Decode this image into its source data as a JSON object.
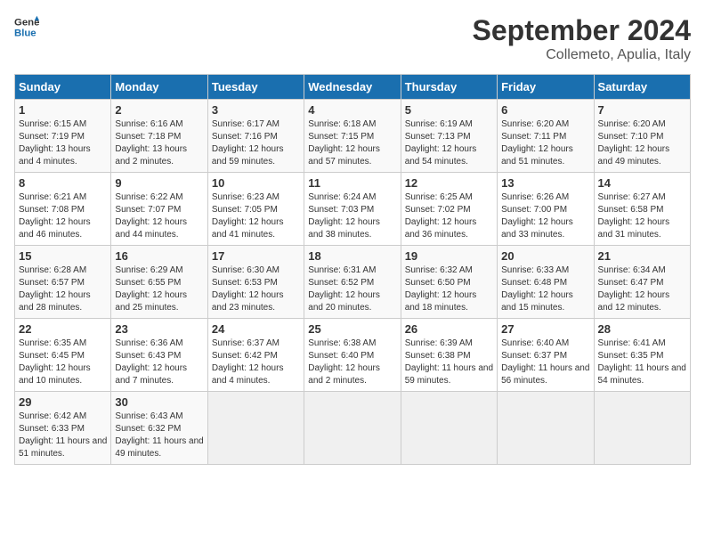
{
  "header": {
    "logo_line1": "General",
    "logo_line2": "Blue",
    "month_title": "September 2024",
    "subtitle": "Collemeto, Apulia, Italy"
  },
  "days_of_week": [
    "Sunday",
    "Monday",
    "Tuesday",
    "Wednesday",
    "Thursday",
    "Friday",
    "Saturday"
  ],
  "weeks": [
    [
      {
        "day": "1",
        "sunrise": "6:15 AM",
        "sunset": "7:19 PM",
        "daylight": "13 hours and 4 minutes."
      },
      {
        "day": "2",
        "sunrise": "6:16 AM",
        "sunset": "7:18 PM",
        "daylight": "13 hours and 2 minutes."
      },
      {
        "day": "3",
        "sunrise": "6:17 AM",
        "sunset": "7:16 PM",
        "daylight": "12 hours and 59 minutes."
      },
      {
        "day": "4",
        "sunrise": "6:18 AM",
        "sunset": "7:15 PM",
        "daylight": "12 hours and 57 minutes."
      },
      {
        "day": "5",
        "sunrise": "6:19 AM",
        "sunset": "7:13 PM",
        "daylight": "12 hours and 54 minutes."
      },
      {
        "day": "6",
        "sunrise": "6:20 AM",
        "sunset": "7:11 PM",
        "daylight": "12 hours and 51 minutes."
      },
      {
        "day": "7",
        "sunrise": "6:20 AM",
        "sunset": "7:10 PM",
        "daylight": "12 hours and 49 minutes."
      }
    ],
    [
      {
        "day": "8",
        "sunrise": "6:21 AM",
        "sunset": "7:08 PM",
        "daylight": "12 hours and 46 minutes."
      },
      {
        "day": "9",
        "sunrise": "6:22 AM",
        "sunset": "7:07 PM",
        "daylight": "12 hours and 44 minutes."
      },
      {
        "day": "10",
        "sunrise": "6:23 AM",
        "sunset": "7:05 PM",
        "daylight": "12 hours and 41 minutes."
      },
      {
        "day": "11",
        "sunrise": "6:24 AM",
        "sunset": "7:03 PM",
        "daylight": "12 hours and 38 minutes."
      },
      {
        "day": "12",
        "sunrise": "6:25 AM",
        "sunset": "7:02 PM",
        "daylight": "12 hours and 36 minutes."
      },
      {
        "day": "13",
        "sunrise": "6:26 AM",
        "sunset": "7:00 PM",
        "daylight": "12 hours and 33 minutes."
      },
      {
        "day": "14",
        "sunrise": "6:27 AM",
        "sunset": "6:58 PM",
        "daylight": "12 hours and 31 minutes."
      }
    ],
    [
      {
        "day": "15",
        "sunrise": "6:28 AM",
        "sunset": "6:57 PM",
        "daylight": "12 hours and 28 minutes."
      },
      {
        "day": "16",
        "sunrise": "6:29 AM",
        "sunset": "6:55 PM",
        "daylight": "12 hours and 25 minutes."
      },
      {
        "day": "17",
        "sunrise": "6:30 AM",
        "sunset": "6:53 PM",
        "daylight": "12 hours and 23 minutes."
      },
      {
        "day": "18",
        "sunrise": "6:31 AM",
        "sunset": "6:52 PM",
        "daylight": "12 hours and 20 minutes."
      },
      {
        "day": "19",
        "sunrise": "6:32 AM",
        "sunset": "6:50 PM",
        "daylight": "12 hours and 18 minutes."
      },
      {
        "day": "20",
        "sunrise": "6:33 AM",
        "sunset": "6:48 PM",
        "daylight": "12 hours and 15 minutes."
      },
      {
        "day": "21",
        "sunrise": "6:34 AM",
        "sunset": "6:47 PM",
        "daylight": "12 hours and 12 minutes."
      }
    ],
    [
      {
        "day": "22",
        "sunrise": "6:35 AM",
        "sunset": "6:45 PM",
        "daylight": "12 hours and 10 minutes."
      },
      {
        "day": "23",
        "sunrise": "6:36 AM",
        "sunset": "6:43 PM",
        "daylight": "12 hours and 7 minutes."
      },
      {
        "day": "24",
        "sunrise": "6:37 AM",
        "sunset": "6:42 PM",
        "daylight": "12 hours and 4 minutes."
      },
      {
        "day": "25",
        "sunrise": "6:38 AM",
        "sunset": "6:40 PM",
        "daylight": "12 hours and 2 minutes."
      },
      {
        "day": "26",
        "sunrise": "6:39 AM",
        "sunset": "6:38 PM",
        "daylight": "11 hours and 59 minutes."
      },
      {
        "day": "27",
        "sunrise": "6:40 AM",
        "sunset": "6:37 PM",
        "daylight": "11 hours and 56 minutes."
      },
      {
        "day": "28",
        "sunrise": "6:41 AM",
        "sunset": "6:35 PM",
        "daylight": "11 hours and 54 minutes."
      }
    ],
    [
      {
        "day": "29",
        "sunrise": "6:42 AM",
        "sunset": "6:33 PM",
        "daylight": "11 hours and 51 minutes."
      },
      {
        "day": "30",
        "sunrise": "6:43 AM",
        "sunset": "6:32 PM",
        "daylight": "11 hours and 49 minutes."
      },
      null,
      null,
      null,
      null,
      null
    ]
  ],
  "labels": {
    "sunrise": "Sunrise:",
    "sunset": "Sunset:",
    "daylight": "Daylight hours"
  }
}
